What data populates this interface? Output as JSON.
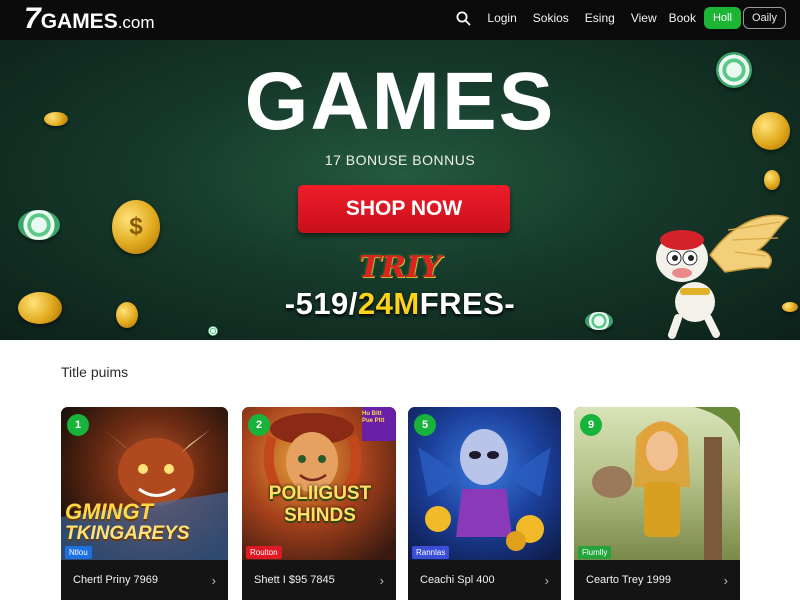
{
  "header": {
    "logo": {
      "seven": "7",
      "name": "GAMES",
      "domain": ".com"
    },
    "search_icon": "search-icon",
    "nav": [
      "Login",
      "Sokios",
      "Esing",
      "View",
      "Book"
    ],
    "cta_primary": "Holl",
    "cta_secondary": "Oaily"
  },
  "hero": {
    "title": "GAMES",
    "subtitle": "17 BONUSE BONNUS",
    "cta": "SHOP NOW",
    "try_label": "TRIY",
    "promo_prefix": "-519/",
    "promo_highlight": "24M",
    "promo_suffix": "FRES-"
  },
  "section": {
    "title": "Title puims"
  },
  "cards": [
    {
      "rank": "1",
      "art_title_a": "GMINGT",
      "art_title_b": "TKINGAREYS",
      "badge": "Ntlou",
      "badge_color": "#1e6fe0",
      "name": "Chertl Priny 7969"
    },
    {
      "rank": "2",
      "art_title_a": "POLIIGUST",
      "art_title_b": "SHINDS",
      "corner_text": "Hu Bitt Pue Pltt",
      "badge": "Roulton",
      "badge_color": "#e01a24",
      "name": "Shett I $95 7845"
    },
    {
      "rank": "5",
      "badge": "Rannlas",
      "badge_color": "#3a4fd6",
      "name": "Ceachi Spl 400"
    },
    {
      "rank": "9",
      "badge": "Flumlly",
      "badge_color": "#22a33c",
      "name": "Cearto Trey 1999"
    }
  ],
  "colors": {
    "accent_green": "#1cb534",
    "cta_red": "#e8141f",
    "hero_green": "#1d4a35",
    "gold": "#f2b928"
  }
}
